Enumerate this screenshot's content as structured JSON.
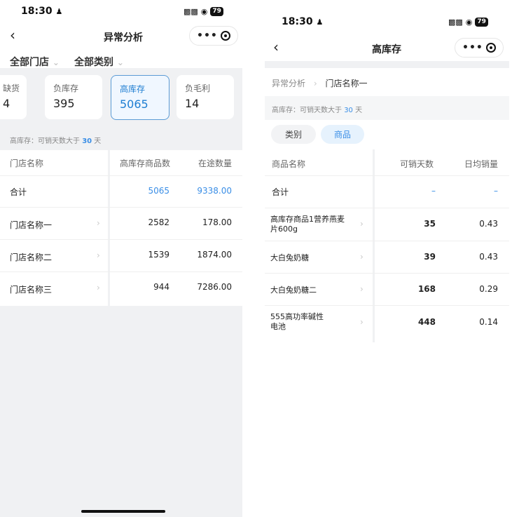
{
  "left": {
    "status": {
      "time": "18:30",
      "battery": "79"
    },
    "nav": {
      "title": "异常分析"
    },
    "filters": [
      {
        "label": "全部门店"
      },
      {
        "label": "全部类别"
      }
    ],
    "cards": [
      {
        "label": "缺货",
        "value": "4"
      },
      {
        "label": "负库存",
        "value": "395"
      },
      {
        "label": "高库存",
        "value": "5065"
      },
      {
        "label": "负毛利",
        "value": "14"
      }
    ],
    "note": {
      "prefix": "高库存：可销天数大于",
      "days": "30",
      "suffix": "天"
    },
    "table": {
      "headers": [
        "门店名称",
        "高库存商品数",
        "在途数量"
      ],
      "total": {
        "name": "合计",
        "count": "5065",
        "transit": "9338.00"
      },
      "rows": [
        {
          "name": "门店名称一",
          "count": "2582",
          "transit": "178.00"
        },
        {
          "name": "门店名称二",
          "count": "1539",
          "transit": "1874.00"
        },
        {
          "name": "门店名称三",
          "count": "944",
          "transit": "7286.00"
        }
      ]
    }
  },
  "right": {
    "status": {
      "time": "18:30",
      "battery": "79"
    },
    "nav": {
      "title": "高库存"
    },
    "breadcrumb": {
      "root": "异常分析",
      "current": "门店名称一"
    },
    "note": {
      "prefix": "高库存：可销天数大于",
      "days": "30",
      "suffix": "天"
    },
    "tabs": [
      {
        "label": "类别"
      },
      {
        "label": "商品"
      }
    ],
    "table": {
      "headers": [
        "商品名称",
        "可销天数",
        "日均销量"
      ],
      "total": {
        "name": "合计",
        "days": "–",
        "daily": "–"
      },
      "rows": [
        {
          "name1": "高库存商品1营养燕麦",
          "name2": "片600g",
          "days": "35",
          "daily": "0.43"
        },
        {
          "name1": "大白兔奶糖",
          "name2": "",
          "days": "39",
          "daily": "0.43"
        },
        {
          "name1": "大白兔奶糖二",
          "name2": "",
          "days": "168",
          "daily": "0.29"
        },
        {
          "name1": "555高功率碱性",
          "name2": "电池",
          "days": "448",
          "daily": "0.14"
        }
      ]
    }
  }
}
